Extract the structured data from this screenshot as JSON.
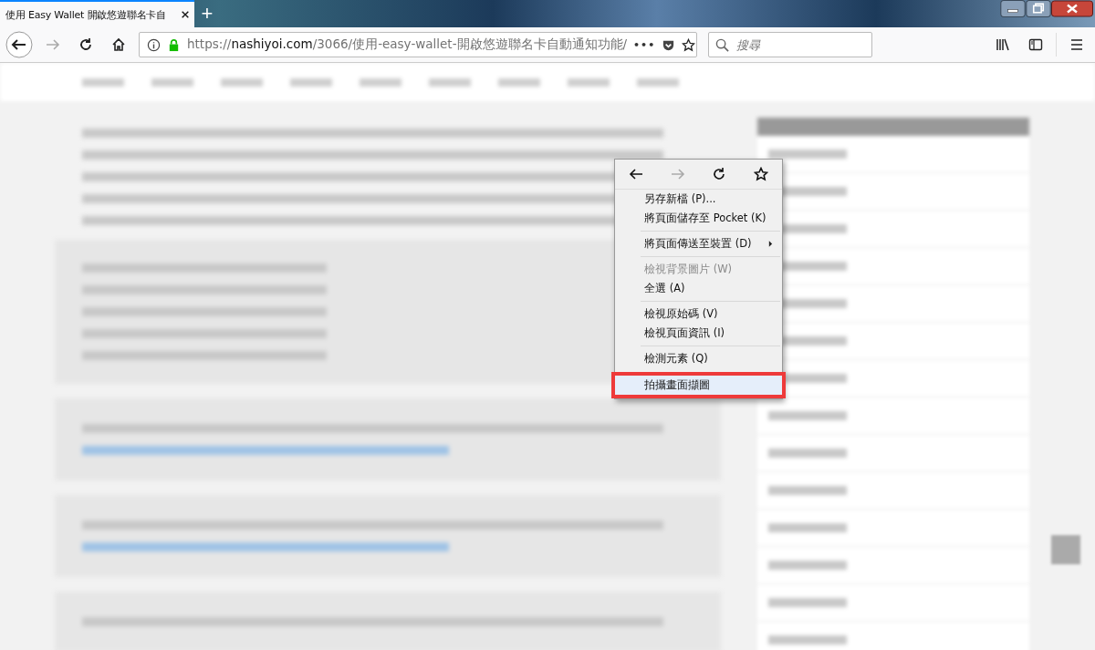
{
  "tab": {
    "title": "使用 Easy Wallet 開啟悠遊聯名卡自",
    "selected": true
  },
  "new_tab": "+",
  "url": {
    "prefix": "https://",
    "domain": "nashiyoi.com",
    "path": "/3066/使用-easy-wallet-開啟悠遊聯名卡自動通知功能/",
    "secure": true
  },
  "page_actions": "•••",
  "search": {
    "placeholder": "搜尋"
  },
  "context_menu": {
    "nav": [
      {
        "kind": "back",
        "disabled": false
      },
      {
        "kind": "forward",
        "disabled": true
      },
      {
        "kind": "reload",
        "disabled": false
      },
      {
        "kind": "bookmark",
        "disabled": false
      }
    ],
    "items": [
      {
        "kind": "item",
        "label": "另存新檔 (P)...",
        "disabled": false,
        "submenu": false,
        "selected": false
      },
      {
        "kind": "item",
        "label": "將頁面儲存至 Pocket (K)",
        "disabled": false,
        "submenu": false,
        "selected": false
      },
      {
        "kind": "separator"
      },
      {
        "kind": "item",
        "label": "將頁面傳送至裝置 (D)",
        "disabled": false,
        "submenu": true,
        "selected": false
      },
      {
        "kind": "separator"
      },
      {
        "kind": "item",
        "label": "檢視背景圖片 (W)",
        "disabled": true,
        "submenu": false,
        "selected": false
      },
      {
        "kind": "item",
        "label": "全選 (A)",
        "disabled": false,
        "submenu": false,
        "selected": false
      },
      {
        "kind": "separator"
      },
      {
        "kind": "item",
        "label": "檢視原始碼 (V)",
        "disabled": false,
        "submenu": false,
        "selected": false
      },
      {
        "kind": "item",
        "label": "檢視頁面資訊 (I)",
        "disabled": false,
        "submenu": false,
        "selected": false
      },
      {
        "kind": "separator"
      },
      {
        "kind": "item",
        "label": "檢測元素 (Q)",
        "disabled": false,
        "submenu": false,
        "selected": false
      },
      {
        "kind": "item",
        "label": "拍攝畫面擷圖",
        "disabled": false,
        "submenu": false,
        "selected": true
      }
    ]
  }
}
